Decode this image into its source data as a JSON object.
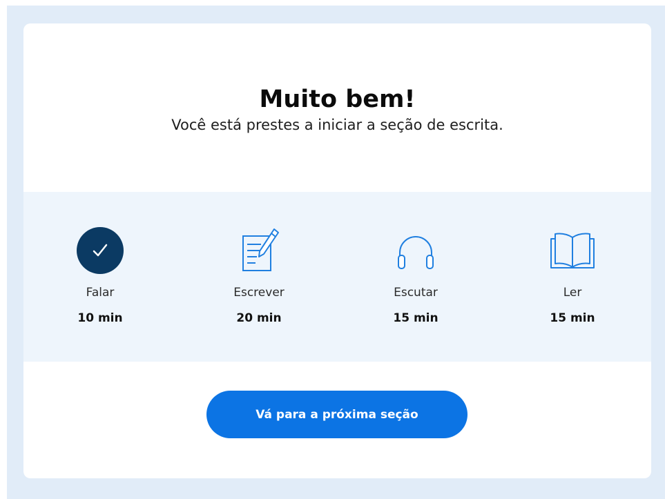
{
  "card": {
    "title": "Muito bem!",
    "subtitle": "Você está prestes a iniciar a seção de escrita."
  },
  "sections": [
    {
      "name": "Falar",
      "duration": "10 min",
      "icon": "check-circle-icon",
      "status": "completed"
    },
    {
      "name": "Escrever",
      "duration": "20 min",
      "icon": "pencil-notepad-icon",
      "status": "current"
    },
    {
      "name": "Escutar",
      "duration": "15 min",
      "icon": "headphones-icon",
      "status": "upcoming"
    },
    {
      "name": "Ler",
      "duration": "15 min",
      "icon": "open-book-icon",
      "status": "upcoming"
    }
  ],
  "next_button": {
    "label": "Vá para a próxima seção"
  },
  "colors": {
    "page_background": "#e1ecf8",
    "band_background": "#eef5fc",
    "completed_fill": "#0b3a63",
    "icon_stroke": "#1f7fe0",
    "button": "#0c74e4"
  }
}
